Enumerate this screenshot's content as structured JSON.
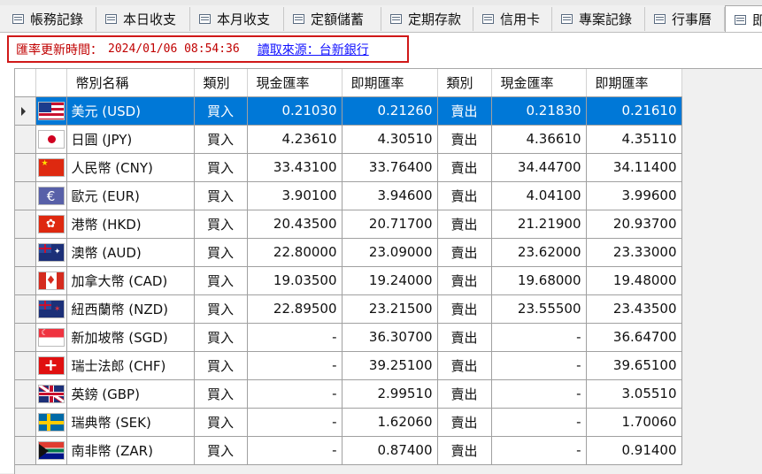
{
  "tabs": [
    {
      "label": "帳務記錄",
      "icon": "table-icon"
    },
    {
      "label": "本日收支",
      "icon": "table-icon"
    },
    {
      "label": "本月收支",
      "icon": "table-icon"
    },
    {
      "label": "定額儲蓄",
      "icon": "table-icon"
    },
    {
      "label": "定期存款",
      "icon": "table-icon"
    },
    {
      "label": "信用卡",
      "icon": "table-icon"
    },
    {
      "label": "專案記錄",
      "icon": "table-icon"
    },
    {
      "label": "行事曆",
      "icon": "table-icon"
    },
    {
      "label": "即",
      "icon": "table-icon"
    }
  ],
  "active_tab_index": 8,
  "rate_bar": {
    "label": "匯率更新時間：",
    "timestamp": "2024/01/06 08:54:36",
    "link": "讀取來源：台新銀行"
  },
  "columns": [
    "幣別名稱",
    "類別",
    "現金匯率",
    "即期匯率",
    "類別",
    "現金匯率",
    "即期匯率"
  ],
  "rows": [
    {
      "flag": "us-flag-icon",
      "name": "美元 (USD)",
      "buy_type": "買入",
      "buy_cash": "0.21030",
      "buy_spot": "0.21260",
      "sell_type": "賣出",
      "sell_cash": "0.21830",
      "sell_spot": "0.21610",
      "selected": true
    },
    {
      "flag": "jp-flag-icon",
      "name": "日圓 (JPY)",
      "buy_type": "買入",
      "buy_cash": "4.23610",
      "buy_spot": "4.30510",
      "sell_type": "賣出",
      "sell_cash": "4.36610",
      "sell_spot": "4.35110"
    },
    {
      "flag": "cn-flag-icon",
      "name": "人民幣 (CNY)",
      "buy_type": "買入",
      "buy_cash": "33.43100",
      "buy_spot": "33.76400",
      "sell_type": "賣出",
      "sell_cash": "34.44700",
      "sell_spot": "34.11400"
    },
    {
      "flag": "eu-flag-icon",
      "name": "歐元 (EUR)",
      "buy_type": "買入",
      "buy_cash": "3.90100",
      "buy_spot": "3.94600",
      "sell_type": "賣出",
      "sell_cash": "4.04100",
      "sell_spot": "3.99600"
    },
    {
      "flag": "hk-flag-icon",
      "name": "港幣 (HKD)",
      "buy_type": "買入",
      "buy_cash": "20.43500",
      "buy_spot": "20.71700",
      "sell_type": "賣出",
      "sell_cash": "21.21900",
      "sell_spot": "20.93700"
    },
    {
      "flag": "au-flag-icon",
      "name": "澳幣 (AUD)",
      "buy_type": "買入",
      "buy_cash": "22.80000",
      "buy_spot": "23.09000",
      "sell_type": "賣出",
      "sell_cash": "23.62000",
      "sell_spot": "23.33000"
    },
    {
      "flag": "ca-flag-icon",
      "name": "加拿大幣 (CAD)",
      "buy_type": "買入",
      "buy_cash": "19.03500",
      "buy_spot": "19.24000",
      "sell_type": "賣出",
      "sell_cash": "19.68000",
      "sell_spot": "19.48000"
    },
    {
      "flag": "nz-flag-icon",
      "name": "紐西蘭幣 (NZD)",
      "buy_type": "買入",
      "buy_cash": "22.89500",
      "buy_spot": "23.21500",
      "sell_type": "賣出",
      "sell_cash": "23.55500",
      "sell_spot": "23.43500"
    },
    {
      "flag": "sg-flag-icon",
      "name": "新加坡幣 (SGD)",
      "buy_type": "買入",
      "buy_cash": "-",
      "buy_spot": "36.30700",
      "sell_type": "賣出",
      "sell_cash": "-",
      "sell_spot": "36.64700"
    },
    {
      "flag": "ch-flag-icon",
      "name": "瑞士法郎 (CHF)",
      "buy_type": "買入",
      "buy_cash": "-",
      "buy_spot": "39.25100",
      "sell_type": "賣出",
      "sell_cash": "-",
      "sell_spot": "39.65100"
    },
    {
      "flag": "gb-flag-icon",
      "name": "英鎊 (GBP)",
      "buy_type": "買入",
      "buy_cash": "-",
      "buy_spot": "2.99510",
      "sell_type": "賣出",
      "sell_cash": "-",
      "sell_spot": "3.05510"
    },
    {
      "flag": "se-flag-icon",
      "name": "瑞典幣 (SEK)",
      "buy_type": "買入",
      "buy_cash": "-",
      "buy_spot": "1.62060",
      "sell_type": "賣出",
      "sell_cash": "-",
      "sell_spot": "1.70060"
    },
    {
      "flag": "za-flag-icon",
      "name": "南非幣 (ZAR)",
      "buy_type": "買入",
      "buy_cash": "-",
      "buy_spot": "0.87400",
      "sell_type": "賣出",
      "sell_cash": "-",
      "sell_spot": "0.91400"
    }
  ],
  "colors": {
    "selection": "#0078d7",
    "alert_border": "#d01818",
    "alert_text": "#c00000",
    "link": "#1010ff"
  }
}
